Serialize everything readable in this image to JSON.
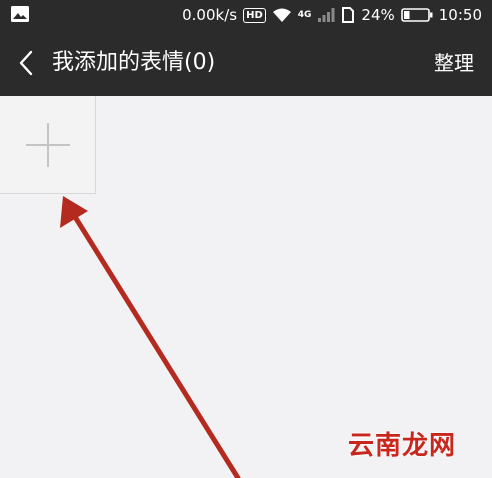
{
  "status_bar": {
    "icons": [
      "gallery-icon",
      "hd-icon",
      "wifi-icon",
      "network-4g-icon",
      "signal-icon",
      "sim-icon",
      "battery-icon"
    ],
    "speed": "0.00k/s",
    "hd_label": "HD",
    "network_label": "4G",
    "battery_percent": "24%",
    "battery_level": 0.24,
    "time": "10:50"
  },
  "title_bar": {
    "title": "我添加的表情(0)",
    "manage_label": "整理"
  },
  "colors": {
    "bar_bg": "#2b2b2b",
    "content_bg": "#f2f1f4",
    "arrow": "#b52a1e",
    "watermark": "#c9271d"
  },
  "watermark": {
    "text": "云南龙网"
  }
}
